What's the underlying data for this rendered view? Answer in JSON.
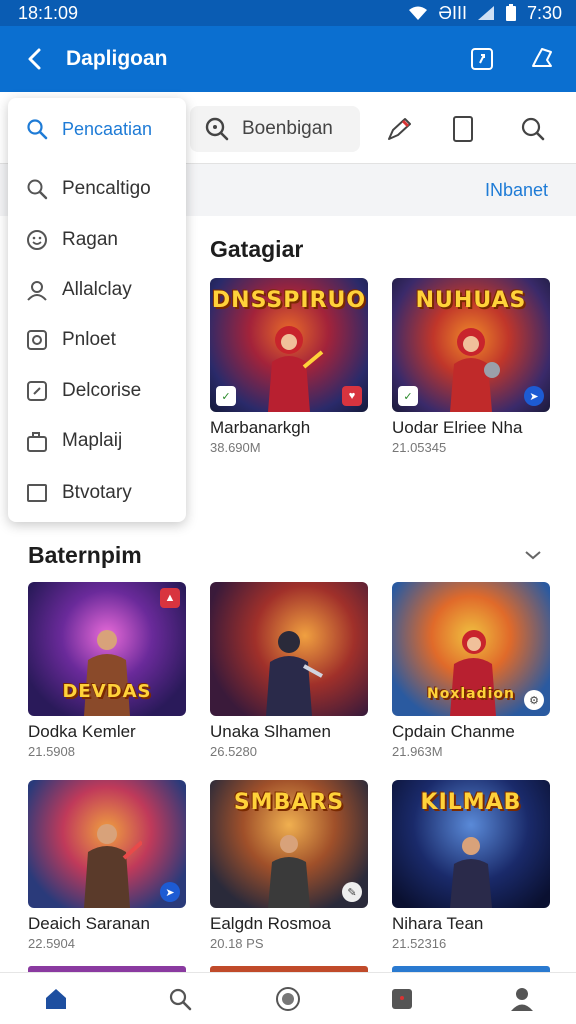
{
  "status": {
    "time_left": "18:1:09",
    "time_right": "7:30",
    "carrier": "ƏIII"
  },
  "appbar": {
    "title": "Dapligoan",
    "back_icon": "back-arrow-icon",
    "action_icons": [
      "open-external-icon",
      "share-icon"
    ]
  },
  "toolbar": {
    "search_placeholder": "Boenbigan",
    "icons": [
      "search-icon",
      "pen-icon",
      "tablet-icon",
      "search-icon"
    ]
  },
  "band": {
    "link": "INbanet"
  },
  "dropdown": {
    "items": [
      {
        "label": "Pencaatian",
        "icon": "search-icon"
      },
      {
        "label": "Pencaltigo",
        "icon": "search-icon"
      },
      {
        "label": "Ragan",
        "icon": "emoji-icon"
      },
      {
        "label": "Allalclay",
        "icon": "people-icon"
      },
      {
        "label": "Pnloet",
        "icon": "square-circle-icon"
      },
      {
        "label": "Delcorise",
        "icon": "edit-box-icon"
      },
      {
        "label": "Maplaij",
        "icon": "bag-icon"
      },
      {
        "label": "Btvotary",
        "icon": "checkbox-icon"
      }
    ]
  },
  "section1": {
    "title": "Gatagiar",
    "cards": [
      {
        "name": "Marbanarkgh",
        "meta": "38.690M",
        "logo": "DNSSPIRUO"
      },
      {
        "name": "Uodar Elriee Nha",
        "meta": "21.05345",
        "logo": "NUHUAS"
      }
    ]
  },
  "section2": {
    "title": "Baternpim",
    "cards": [
      {
        "name": "Dodka Kemler",
        "meta": "21.5908",
        "logo": "DEVDAS"
      },
      {
        "name": "Unaka Slhamen",
        "meta": "26.5280",
        "logo": ""
      },
      {
        "name": "Cpdain Chanme",
        "meta": "21.963M",
        "logo": "Noxladion"
      },
      {
        "name": "Deaich Saranan",
        "meta": "22.5904",
        "logo": ""
      },
      {
        "name": "Ealgdn Rosmoa",
        "meta": "20.18 PS",
        "logo": "SMBARS"
      },
      {
        "name": "Nihara Tean",
        "meta": "21.52316",
        "logo": "KILMAB"
      }
    ]
  },
  "bottomnav": {
    "icons": [
      "home-icon",
      "search-icon",
      "compass-icon",
      "bookmark-icon",
      "profile-icon"
    ]
  },
  "colors": {
    "appbar": "#0b6fd0",
    "statusbar": "#0a5cb3",
    "accent": "#1e7bd6"
  }
}
